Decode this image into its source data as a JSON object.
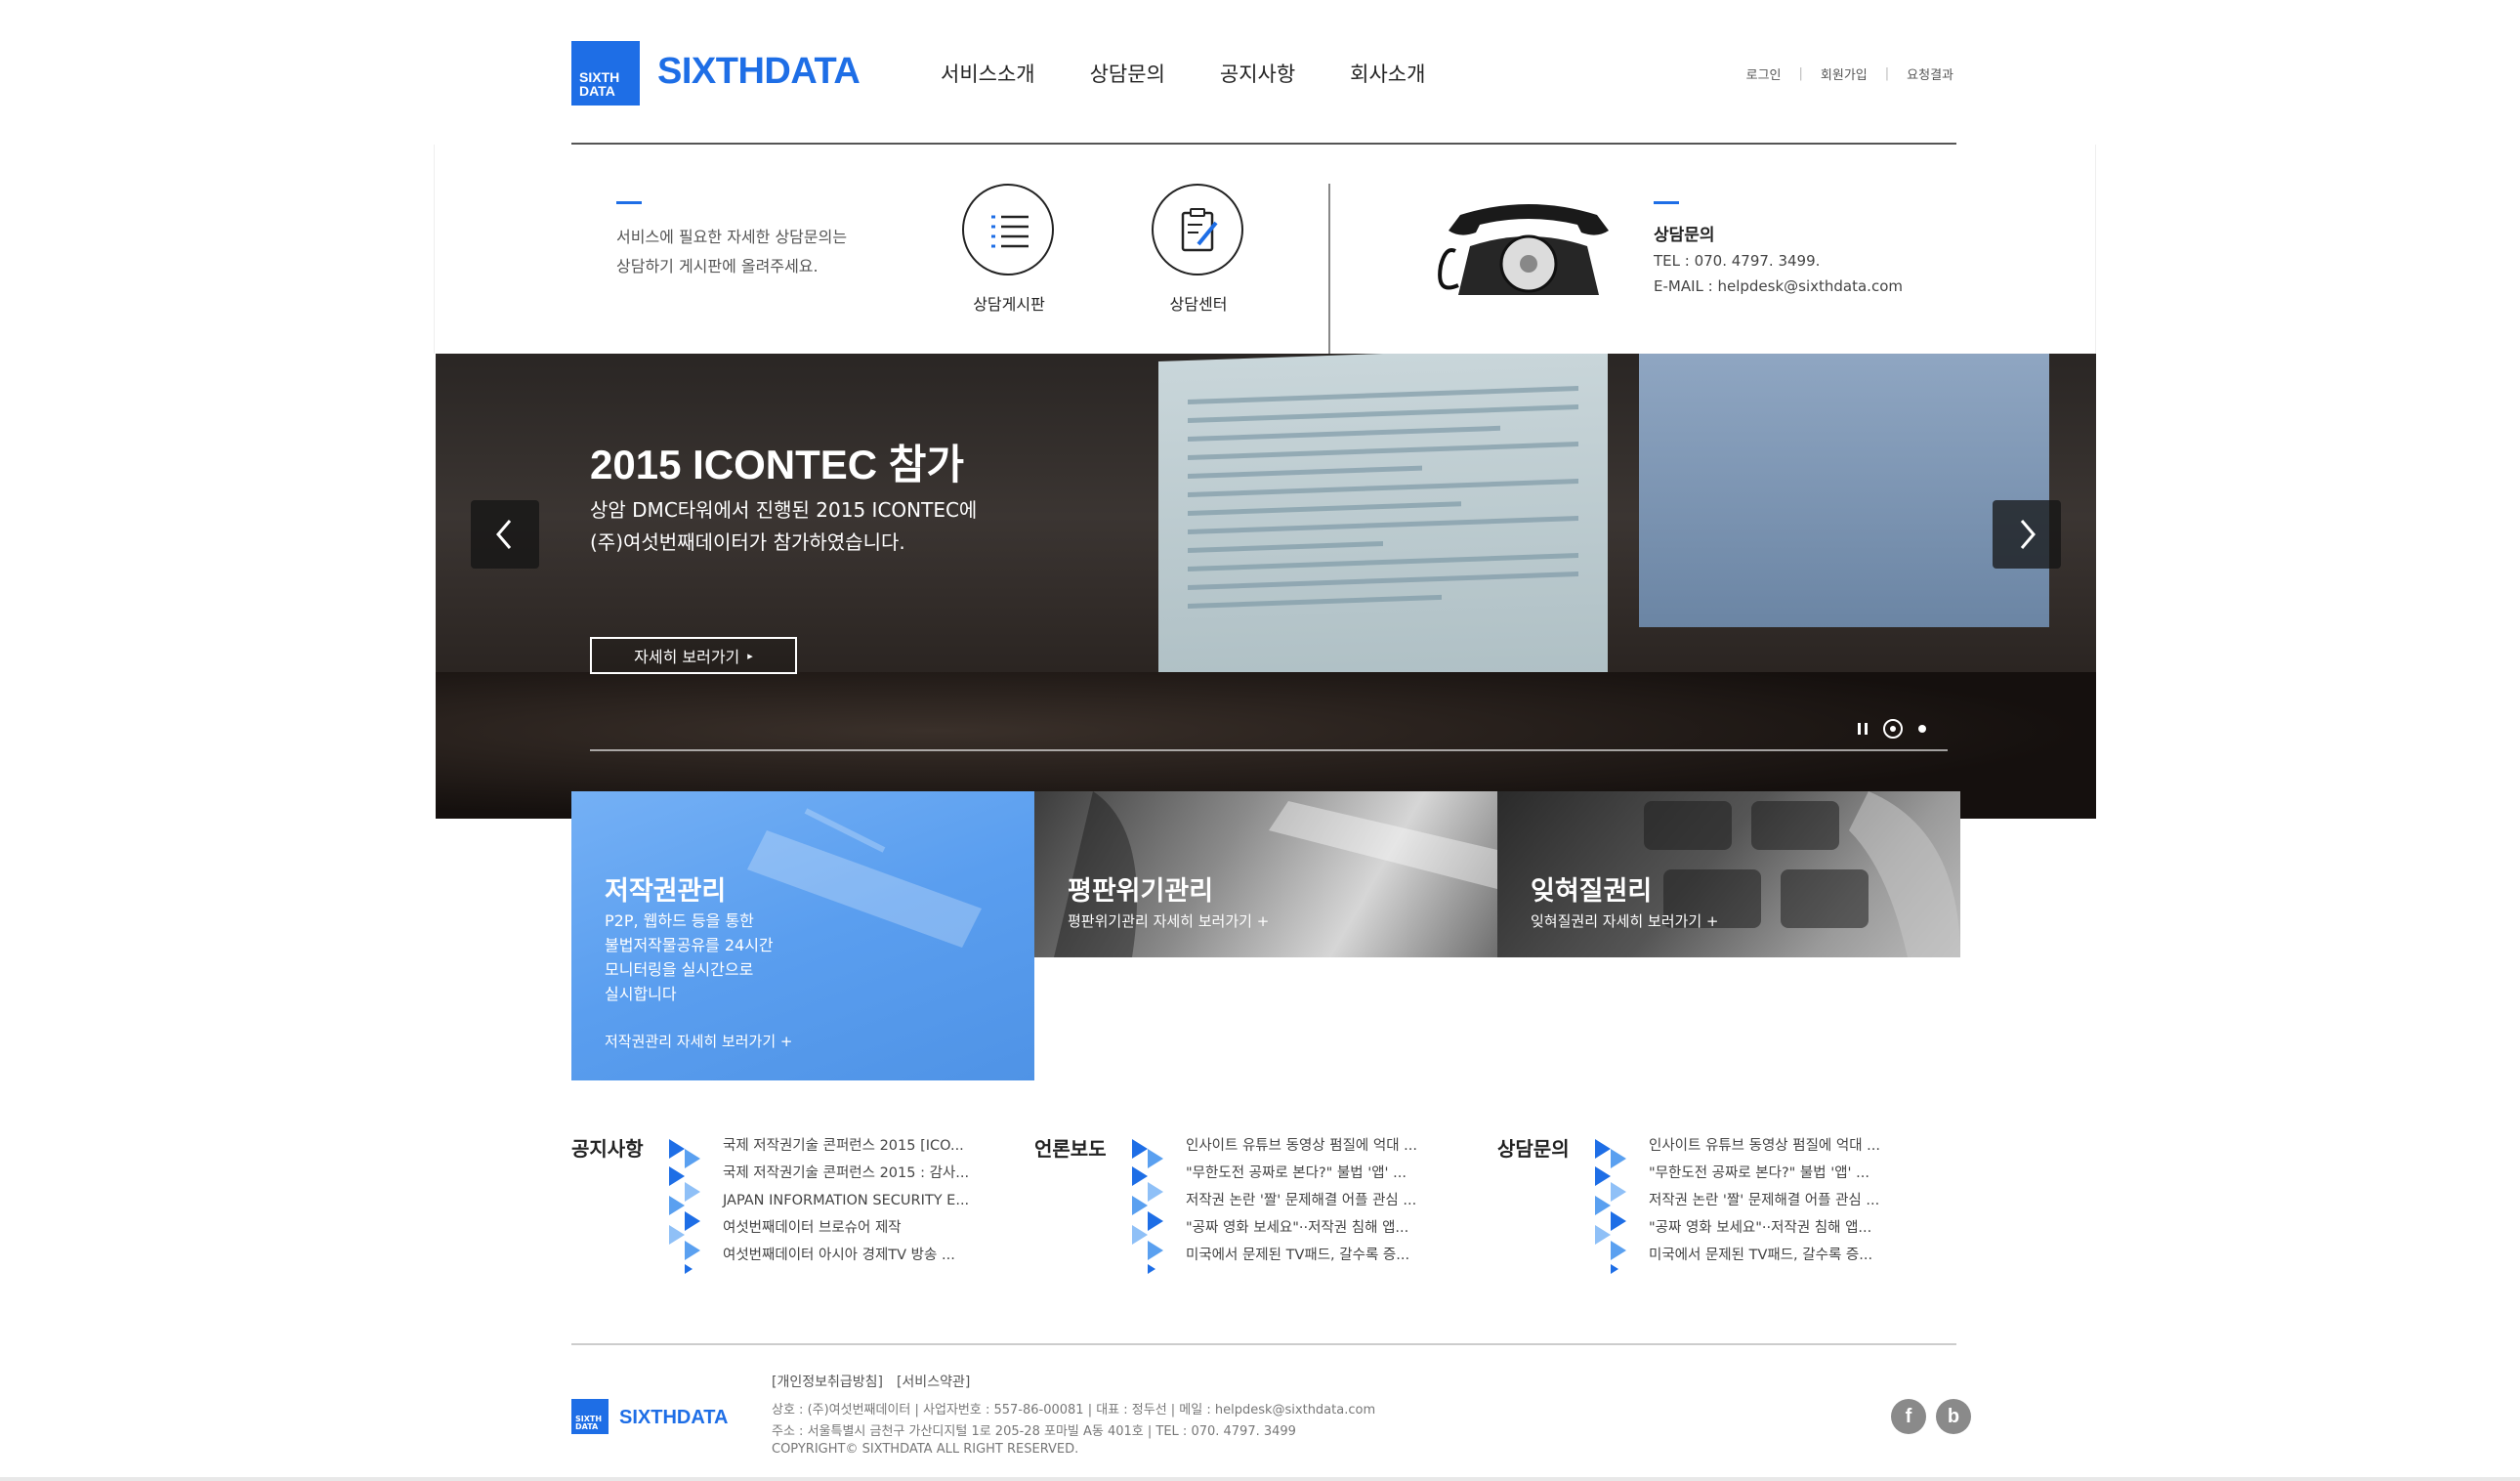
{
  "header": {
    "logo_badge_line1": "SIXTH",
    "logo_badge_line2": "DATA",
    "logo_text": "SIXTHDATA",
    "nav": [
      "서비스소개",
      "상담문의",
      "공지사항",
      "회사소개"
    ],
    "util": [
      "로그인",
      "회원가입",
      "요청결과"
    ]
  },
  "consult": {
    "desc_line1": "서비스에 필요한 자세한 상담문의는",
    "desc_line2": "상담하기 게시판에 올려주세요.",
    "board_label": "상담게시판",
    "center_label": "상담센터",
    "info_title": "상담문의",
    "tel": "TEL : 070. 4797. 3499.",
    "email": "E-MAIL : helpdesk@sixthdata.com"
  },
  "hero": {
    "title": "2015 ICONTEC 참가",
    "sub_line1": "상암 DMC타워에서 진행된 2015 ICONTEC에",
    "sub_line2": "(주)여섯번째데이터가 참가하였습니다.",
    "button": "자세히 보러가기",
    "button_arrow": "▸"
  },
  "tiles": [
    {
      "title": "저작권관리",
      "desc": [
        "P2P, 웹하드 등을 통한",
        "불법저작물공유를 24시간",
        "모니터링을 실시간으로",
        "실시합니다"
      ],
      "link": "저작권관리 자세히 보러가기 +",
      "color": "#5aa0f0"
    },
    {
      "title": "평판위기관리",
      "link": "평판위기관리 자세히 보러가기 +"
    },
    {
      "title": "잊혀질권리",
      "link": "잊혀질권리 자세히 보러가기 +"
    }
  ],
  "boards": [
    {
      "title": "공지사항",
      "items": [
        "국제 저작권기술 콘퍼런스 2015 [ICO...",
        "국제 저작권기술 콘퍼런스 2015 : 감사...",
        "JAPAN INFORMATION SECURITY E...",
        "여섯번째데이터 브로슈어 제작",
        "여섯번째데이터 아시아 경제TV 방송 ..."
      ]
    },
    {
      "title": "언론보도",
      "items": [
        "인사이트 유튜브 동영상 펌질에 억대 ...",
        "\"무한도전 공짜로 본다?\" 불법 '앱' ...",
        "저작권 논란 '짤' 문제해결 어플 관심 ...",
        "\"공짜 영화 보세요\"··저작권 침해 앱...",
        "미국에서 문제된 TV패드, 갈수록 증..."
      ]
    },
    {
      "title": "상담문의",
      "items": [
        "인사이트 유튜브 동영상 펌질에 억대 ...",
        "\"무한도전 공짜로 본다?\" 불법 '앱' ...",
        "저작권 논란 '짤' 문제해결 어플 관심 ...",
        "\"공짜 영화 보세요\"··저작권 침해 앱...",
        "미국에서 문제된 TV패드, 갈수록 증..."
      ]
    }
  ],
  "footer": {
    "logo_badge_line1": "SIXTH",
    "logo_badge_line2": "DATA",
    "logo_text": "SIXTHDATA",
    "links": [
      "[개인정보취급방침]",
      "[서비스약관]"
    ],
    "line1": "상호 : (주)여섯번째데이터 | 사업자번호 : 557-86-00081 | 대표 : 정두선 | 메일 : helpdesk@sixthdata.com",
    "line2": "주소 : 서울특별시 금천구 가산디지털 1로 205-28 포마빌 A동 401호 | TEL : 070. 4797. 3499",
    "line3": "COPYRIGHT© SIXTHDATA ALL RIGHT RESERVED.",
    "sns": [
      "f",
      "b"
    ]
  },
  "colors": {
    "brand": "#1e6ee6",
    "tile_blue": "#5aa0f0"
  }
}
